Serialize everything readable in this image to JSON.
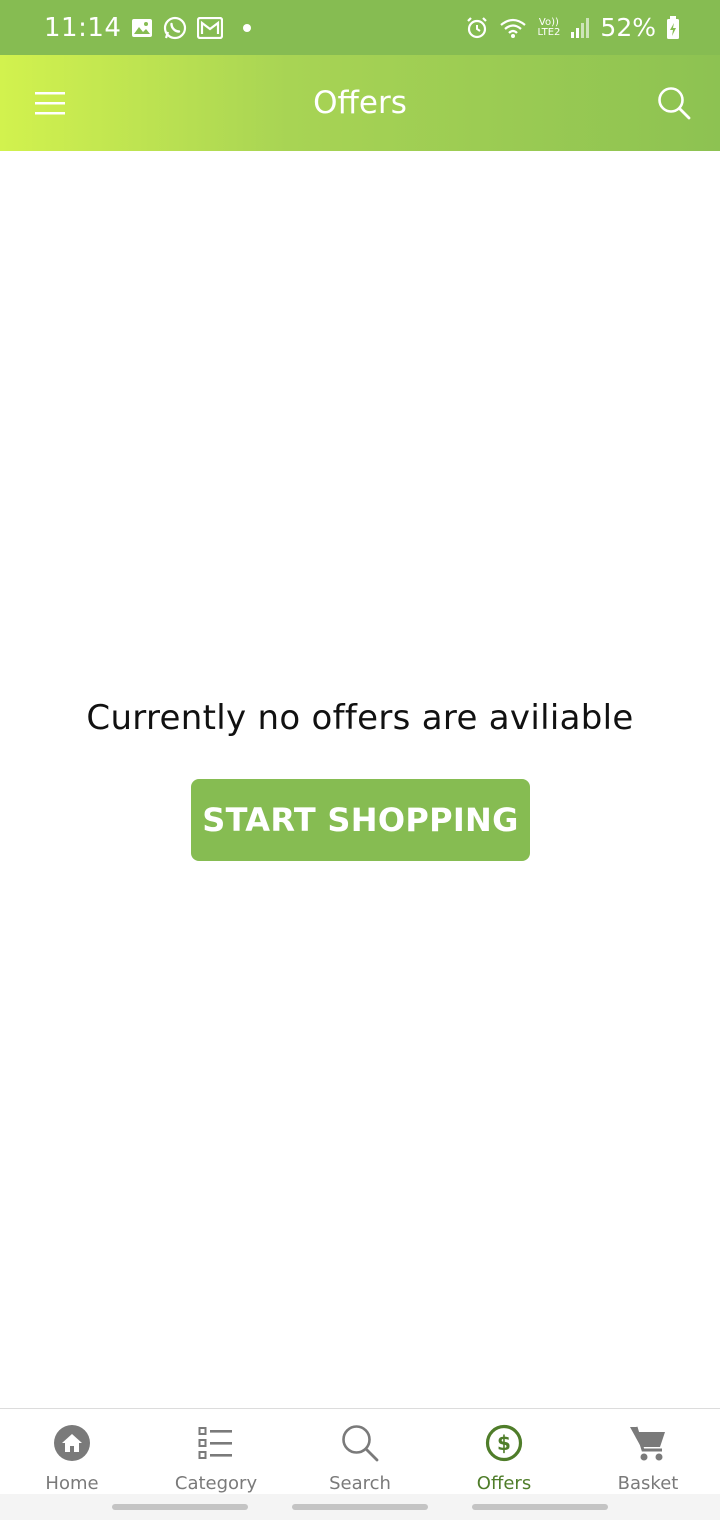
{
  "status_bar": {
    "time": "11:14",
    "battery_percent": "52%",
    "network_label_top": "Vo))",
    "network_label_bottom": "LTE2"
  },
  "app_bar": {
    "title": "Offers",
    "menu_icon": "hamburger-menu-icon",
    "search_icon": "search-icon"
  },
  "main": {
    "empty_message": "Currently no offers are aviliable",
    "start_button_label": "START SHOPPING"
  },
  "bottom_nav": {
    "items": [
      {
        "label": "Home",
        "icon": "home-icon",
        "active": false
      },
      {
        "label": "Category",
        "icon": "list-icon",
        "active": false
      },
      {
        "label": "Search",
        "icon": "search-icon",
        "active": false
      },
      {
        "label": "Offers",
        "icon": "dollar-circle-icon",
        "active": true
      },
      {
        "label": "Basket",
        "icon": "cart-icon",
        "active": false
      }
    ]
  },
  "colors": {
    "primary": "#86bc52",
    "active_nav": "#4f7d2a",
    "inactive_nav": "#7a7a7a",
    "gradient_start": "#d2f24e"
  }
}
